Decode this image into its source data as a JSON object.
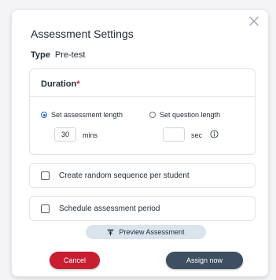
{
  "dialog": {
    "title": "Assessment Settings",
    "type_label": "Type",
    "type_value": "Pre-test"
  },
  "duration": {
    "title": "Duration",
    "required_mark": "*",
    "option_assessment_length": "Set assessment length",
    "option_question_length": "Set question length",
    "selected_option": "Set assessment length",
    "assessment_length_value": "30",
    "assessment_length_unit": "mins",
    "question_length_value": "",
    "question_length_unit": "sec"
  },
  "options": {
    "random_sequence_label": "Create random sequence per student",
    "random_sequence_checked": false,
    "schedule_period_label": "Schedule assessment period",
    "schedule_period_checked": false
  },
  "actions": {
    "preview_label": "Preview Assessment",
    "cancel_label": "Cancel",
    "assign_label": "Assign now"
  },
  "colors": {
    "cancel": "#c81e32",
    "assign": "#3d4f61",
    "preview_bg": "#dbe3ec",
    "radio_selected": "#2563eb",
    "required": "#c0202e"
  },
  "icons": {
    "close": "close-icon",
    "info": "info-icon",
    "preview": "preview-icon"
  }
}
